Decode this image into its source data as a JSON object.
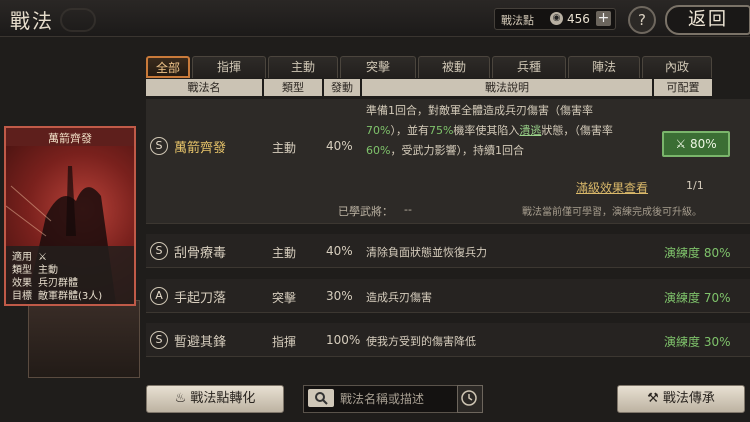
{
  "header": {
    "title": "戰法",
    "points_label": "戰法點",
    "points_icon": "coin-icon",
    "points_value": "456",
    "add_symbol": "+",
    "help_symbol": "?",
    "back_label": "返回"
  },
  "tabs": [
    "全部",
    "指揮",
    "主動",
    "突擊",
    "被動",
    "兵種",
    "陣法",
    "內政"
  ],
  "columns": [
    "戰法名",
    "類型",
    "發動",
    "戰法說明",
    "可配置"
  ],
  "tactics": [
    {
      "grade": "S",
      "name": "萬箭齊發",
      "type": "主動",
      "rate": "40%",
      "desc_1": "準備1回合，對敵軍全體造成兵刃傷害（傷害率",
      "desc_2a": "70%",
      "desc_2b": "），並有",
      "desc_2c": "75%",
      "desc_2d": "機率使其陷入",
      "desc_2e": "潰逃",
      "desc_2f": "狀態，（傷害率",
      "desc_3a": "60%",
      "desc_3b": "，受武力影響），持續1回合",
      "assign_label": "80%",
      "max_effect_link": "滿級效果查看",
      "progress": "1/1",
      "learned_label": "已學武將：",
      "learned_value": "--",
      "note": "戰法當前僅可學習，演練完成後可升級。"
    },
    {
      "grade": "S",
      "name": "刮骨療毒",
      "type": "主動",
      "rate": "40%",
      "desc": "清除負面狀態並恢復兵力",
      "proficiency": "演練度 80%"
    },
    {
      "grade": "A",
      "name": "手起刀落",
      "type": "突擊",
      "rate": "30%",
      "desc": "造成兵刃傷害",
      "proficiency": "演練度 70%"
    },
    {
      "grade": "S",
      "name": "暫避其鋒",
      "type": "指揮",
      "rate": "100%",
      "desc": "使我方受到的傷害降低",
      "proficiency": "演練度 30%"
    }
  ],
  "card": {
    "title": "萬箭齊發",
    "rows": [
      {
        "k": "適用",
        "v": ""
      },
      {
        "k": "類型",
        "v": "主動"
      },
      {
        "k": "效果",
        "v": "兵刃群體"
      },
      {
        "k": "目標",
        "v": "敵軍群體(3人)"
      }
    ]
  },
  "footer": {
    "convert_label": "戰法點轉化",
    "search_placeholder": "戰法名稱或描述",
    "inherit_label": "戰法傳承"
  }
}
